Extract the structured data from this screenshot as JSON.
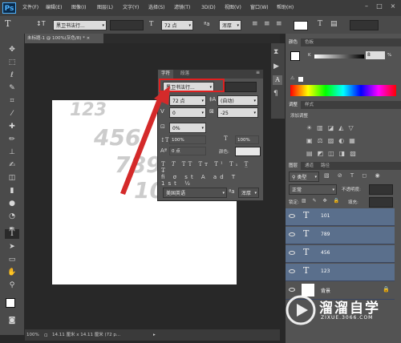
{
  "app": {
    "logo": "Ps"
  },
  "menu": [
    "文件(F)",
    "编辑(E)",
    "图像(I)",
    "图层(L)",
    "文字(Y)",
    "选择(S)",
    "滤镜(T)",
    "3D(D)",
    "视图(V)",
    "窗口(W)",
    "帮助(H)"
  ],
  "options": {
    "font_family": "黑卫书法行...",
    "font_size": "72 点",
    "antialias": "浑厚"
  },
  "document": {
    "tab_title": "未标题-1 @ 100%(灰色/8) *",
    "layer_texts": [
      "123",
      "456",
      "789",
      "101"
    ]
  },
  "status": {
    "zoom": "100%",
    "info": "14.11 厘米 x 14.11 厘米 (72 p..."
  },
  "char_panel": {
    "tab_char": "字符",
    "tab_para": "段落",
    "font_family": "黑卫书法行...",
    "font_size": "72 点",
    "leading": "(自动)",
    "kerning": "0",
    "tracking": "-25",
    "scale_pct": "0%",
    "vscale": "100%",
    "hscale": "100%",
    "baseline": "0 点",
    "color_label": "颜色:",
    "language": "美国英语",
    "antialias": "浑厚"
  },
  "right": {
    "color_tab": "颜色",
    "swatch_tab": "色板",
    "k_label": "K",
    "k_value": "8",
    "k_unit": "%",
    "adjust_tab": "调整",
    "style_tab": "样式",
    "adjust_title": "添加调整",
    "layers_tab": "图层",
    "channels_tab": "通道",
    "paths_tab": "路径",
    "kind_label": "类型",
    "blend_mode": "正常",
    "opacity_label": "不透明度:",
    "lock_label": "锁定:",
    "fill_label": "填充:",
    "layers": [
      "101",
      "789",
      "456",
      "123"
    ],
    "bg_layer": "背景"
  },
  "watermark": {
    "title": "溜溜自学",
    "url": "ZIXUE.3066.COM"
  },
  "colors": {
    "highlight_box": "#e02020",
    "arrow": "#d42a2a",
    "layer_selected": "#5a6f8c"
  }
}
